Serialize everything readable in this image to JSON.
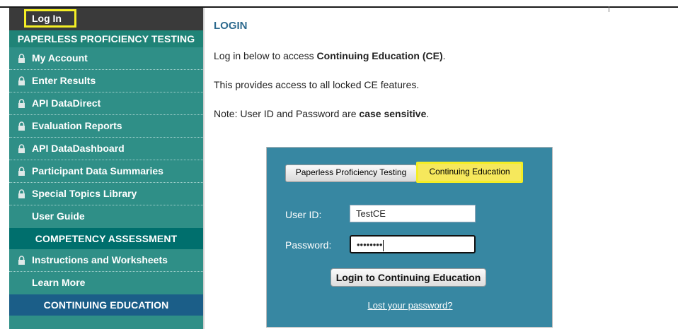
{
  "sidebar": {
    "login_label": "Log In",
    "sections": {
      "ppt": "PAPERLESS PROFICIENCY TESTING",
      "competency": "COMPETENCY ASSESSMENT",
      "ce": "CONTINUING EDUCATION"
    },
    "ppt_items": [
      {
        "label": "My Account",
        "icon": "lock-icon"
      },
      {
        "label": "Enter Results",
        "icon": "lock-icon"
      },
      {
        "label": "API DataDirect",
        "icon": "lock-icon"
      },
      {
        "label": "Evaluation Reports",
        "icon": "lock-icon"
      },
      {
        "label": "API DataDashboard",
        "icon": "lock-icon"
      },
      {
        "label": "Participant Data Summaries",
        "icon": "lock-icon"
      },
      {
        "label": "Special Topics Library",
        "icon": "lock-icon"
      },
      {
        "label": "User Guide",
        "icon": null
      }
    ],
    "competency_items": [
      {
        "label": "Instructions and Worksheets",
        "icon": "lock-icon"
      },
      {
        "label": "Learn More",
        "icon": null
      }
    ]
  },
  "main": {
    "title": "LOGIN",
    "line1_pre": "Log in below to access ",
    "line1_bold": "Continuing Education (CE)",
    "line1_post": ".",
    "line2": "This provides access to all locked CE features.",
    "line3_pre": "Note: User ID and Password are ",
    "line3_bold": "case sensitive",
    "line3_post": "."
  },
  "login_panel": {
    "tab_ppt": "Paperless Proficiency Testing",
    "tab_ce": "Continuing Education",
    "userid_label": "User ID:",
    "userid_value": "TestCE",
    "password_label": "Password:",
    "password_value": "••••••••",
    "login_button": "Login to Continuing Education",
    "lost_password": "Lost your password?"
  },
  "colors": {
    "sidebar_bg": "#2f8f87",
    "highlight": "#f4ee25",
    "panel_bg": "#3787a2",
    "title_color": "#2d6a8e"
  }
}
